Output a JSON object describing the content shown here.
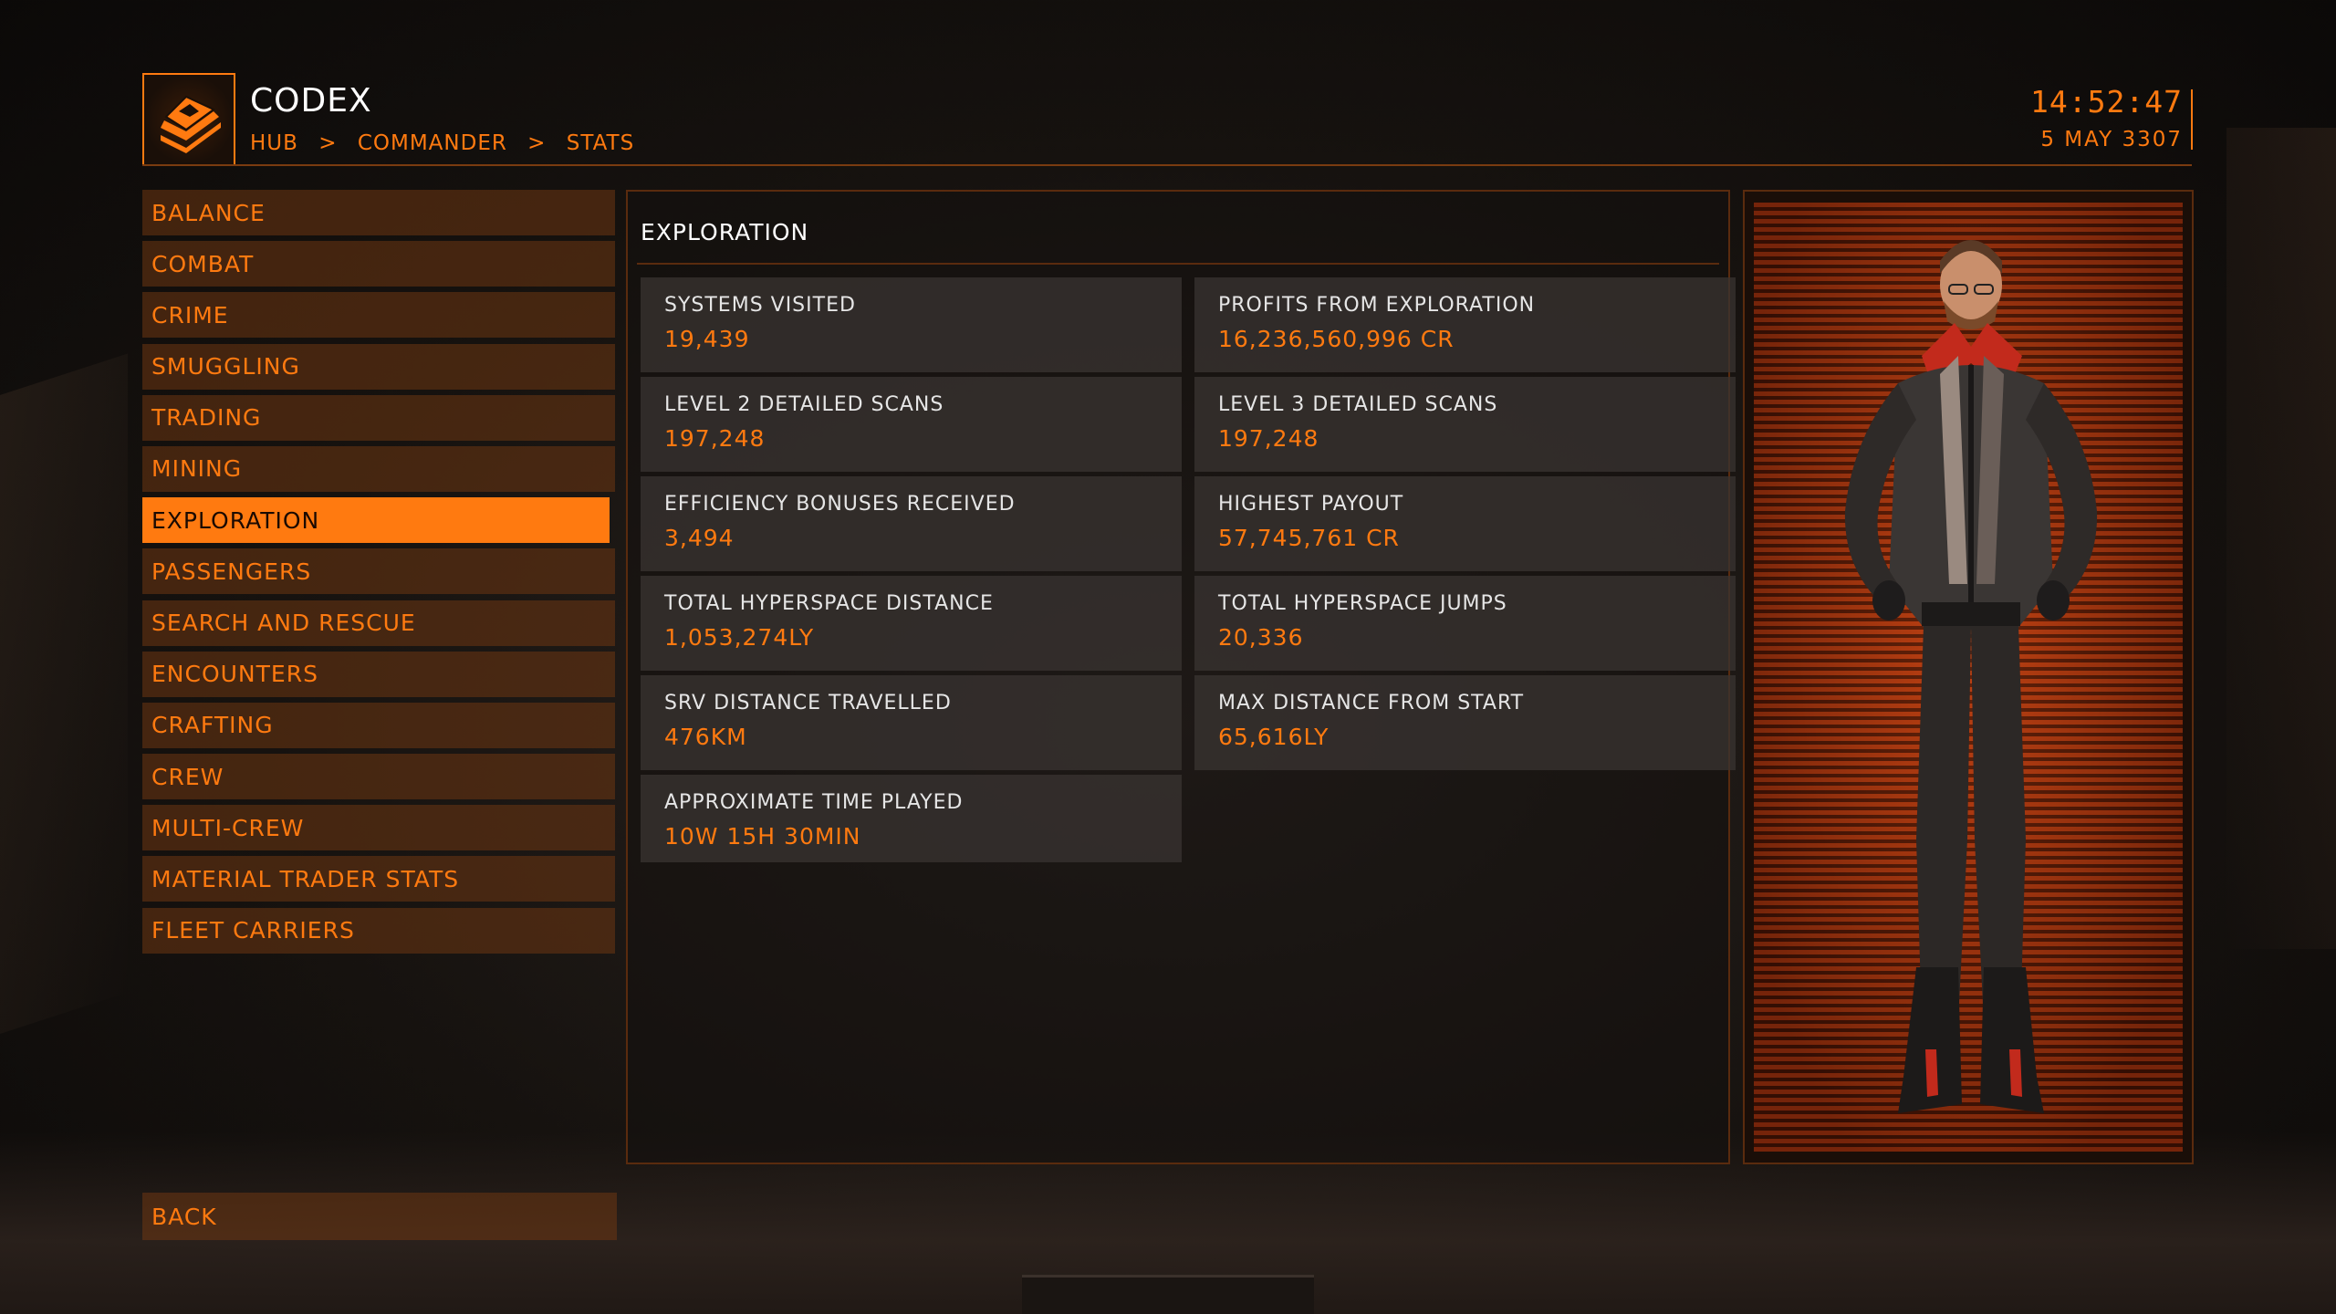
{
  "header": {
    "title": "CODEX",
    "breadcrumb": [
      "HUB",
      ">",
      "COMMANDER",
      ">",
      "STATS"
    ],
    "time": "14:52:47",
    "date": "5 MAY 3307"
  },
  "sidebar": {
    "items": [
      {
        "label": "BALANCE",
        "active": false
      },
      {
        "label": "COMBAT",
        "active": false
      },
      {
        "label": "CRIME",
        "active": false
      },
      {
        "label": "SMUGGLING",
        "active": false
      },
      {
        "label": "TRADING",
        "active": false
      },
      {
        "label": "MINING",
        "active": false
      },
      {
        "label": "EXPLORATION",
        "active": true
      },
      {
        "label": "PASSENGERS",
        "active": false
      },
      {
        "label": "SEARCH AND RESCUE",
        "active": false
      },
      {
        "label": "ENCOUNTERS",
        "active": false
      },
      {
        "label": "CRAFTING",
        "active": false
      },
      {
        "label": "CREW",
        "active": false
      },
      {
        "label": "MULTI-CREW",
        "active": false
      },
      {
        "label": "MATERIAL TRADER STATS",
        "active": false
      },
      {
        "label": "FLEET CARRIERS",
        "active": false
      }
    ],
    "back_label": "BACK"
  },
  "main": {
    "section_title": "EXPLORATION",
    "stats": [
      {
        "label": "SYSTEMS VISITED",
        "value": "19,439"
      },
      {
        "label": "PROFITS FROM EXPLORATION",
        "value": "16,236,560,996 CR"
      },
      {
        "label": "LEVEL 2 DETAILED SCANS",
        "value": "197,248"
      },
      {
        "label": "LEVEL 3 DETAILED SCANS",
        "value": "197,248"
      },
      {
        "label": "EFFICIENCY BONUSES RECEIVED",
        "value": "3,494"
      },
      {
        "label": "HIGHEST PAYOUT",
        "value": "57,745,761 CR"
      },
      {
        "label": "TOTAL HYPERSPACE DISTANCE",
        "value": "1,053,274LY"
      },
      {
        "label": "TOTAL HYPERSPACE JUMPS",
        "value": "20,336"
      },
      {
        "label": "SRV DISTANCE TRAVELLED",
        "value": "476KM"
      },
      {
        "label": "MAX DISTANCE FROM START",
        "value": "65,616LY"
      },
      {
        "label": "APPROXIMATE TIME PLAYED",
        "value": "10W 15H 30MIN"
      }
    ]
  },
  "colors": {
    "accent": "#ff7a10",
    "panel": "#3a3431",
    "text_light": "#e6e6e6"
  },
  "icons": {
    "logo": "codex-book-icon"
  }
}
